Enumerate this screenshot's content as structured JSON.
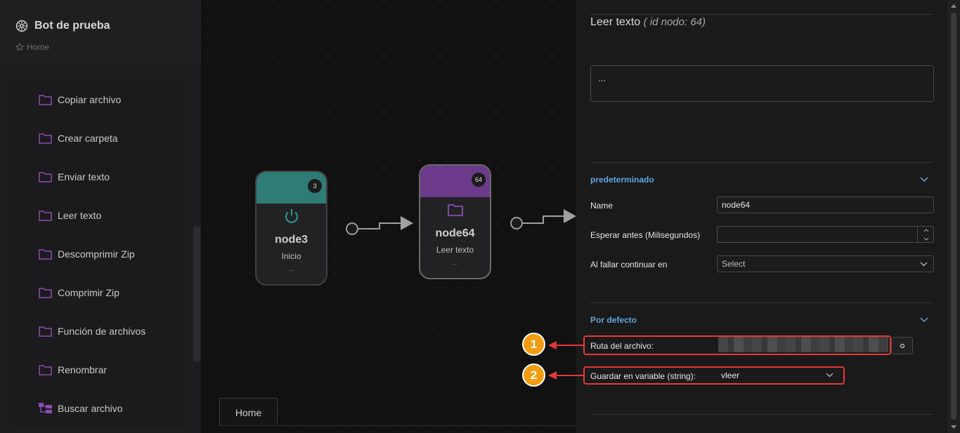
{
  "sidebar": {
    "title": "Bot de prueba",
    "home_link": "Home",
    "items": [
      {
        "label": "Copiar archivo",
        "icon": "folder-icon"
      },
      {
        "label": "Crear carpeta",
        "icon": "folder-icon"
      },
      {
        "label": "Enviar texto",
        "icon": "folder-icon"
      },
      {
        "label": "Leer texto",
        "icon": "folder-icon"
      },
      {
        "label": "Descomprimir Zip",
        "icon": "folder-icon"
      },
      {
        "label": "Comprimir Zip",
        "icon": "folder-icon"
      },
      {
        "label": "Función de archivos",
        "icon": "folder-icon"
      },
      {
        "label": "Renombrar",
        "icon": "folder-icon"
      },
      {
        "label": "Buscar archivo",
        "icon": "folder-tree-icon"
      }
    ]
  },
  "canvas": {
    "nodes": [
      {
        "id_badge": "3",
        "title": "node3",
        "subtitle": "Inicio",
        "dots": "...",
        "icon": "power-icon",
        "color": "#2f7c76"
      },
      {
        "id_badge": "64",
        "title": "node64",
        "subtitle": "Leer texto",
        "dots": "...",
        "icon": "folder-icon",
        "color": "#6c3a8a"
      }
    ],
    "tab_label": "Home"
  },
  "panel": {
    "title": "Leer texto",
    "title_id": "( id nodo: 64)",
    "description": "...",
    "section1": {
      "title": "predeterminado",
      "name_label": "Name",
      "name_value": "node64",
      "wait_label": "Esperar antes (Milisegundos)",
      "wait_value": "",
      "fail_label": "Al fallar continuar en",
      "fail_value": "Select"
    },
    "section2": {
      "title": "Por defecto",
      "path_label": "Ruta del archivo:",
      "var_label": "Guardar en variable (string):",
      "var_value": "vleer"
    },
    "callouts": [
      "1",
      "2"
    ],
    "accent_color": "#5fa6dc",
    "highlight_color": "#e53935",
    "callout_color": "#f39c12"
  }
}
